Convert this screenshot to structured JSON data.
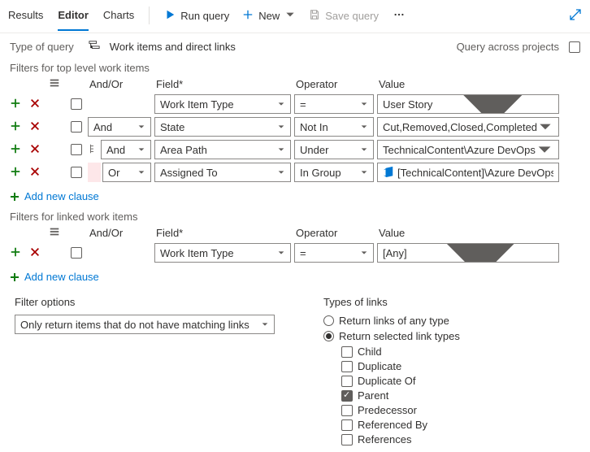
{
  "tabs": {
    "results": "Results",
    "editor": "Editor",
    "charts": "Charts"
  },
  "toolbar": {
    "run": "Run query",
    "new": "New",
    "save": "Save query"
  },
  "typeOfQuery": {
    "label": "Type of query",
    "value": "Work items and direct links"
  },
  "queryAcross": "Query across projects",
  "headers": {
    "andor": "And/Or",
    "field": "Field*",
    "operator": "Operator",
    "value": "Value"
  },
  "sectionTop": "Filters for top level work items",
  "sectionLinked": "Filters for linked work items",
  "addNewClause": "Add new clause",
  "topClauses": [
    {
      "andor": "",
      "group": false,
      "field": "Work Item Type",
      "op": "=",
      "value": "User Story"
    },
    {
      "andor": "And",
      "group": false,
      "field": "State",
      "op": "Not In",
      "value": "Cut,Removed,Closed,Completed"
    },
    {
      "andor": "And",
      "group": true,
      "field": "Area Path",
      "op": "Under",
      "value": "TechnicalContent\\Azure DevOps"
    },
    {
      "andor": "Or",
      "group": false,
      "pink": true,
      "field": "Assigned To",
      "op": "In Group",
      "value": "[TechnicalContent]\\Azure DevOps",
      "valueIcon": true,
      "valueNoChevron": true
    }
  ],
  "linkedClauses": [
    {
      "andor": "",
      "field": "Work Item Type",
      "op": "=",
      "value": "[Any]"
    }
  ],
  "filterOptions": {
    "label": "Filter options",
    "value": "Only return items that do not have matching links"
  },
  "linkTypes": {
    "label": "Types of links",
    "radioAny": "Return links of any type",
    "radioSelected": "Return selected link types",
    "options": {
      "child": "Child",
      "duplicate": "Duplicate",
      "duplicateOf": "Duplicate Of",
      "parent": "Parent",
      "predecessor": "Predecessor",
      "referencedBy": "Referenced By",
      "references": "References"
    }
  }
}
